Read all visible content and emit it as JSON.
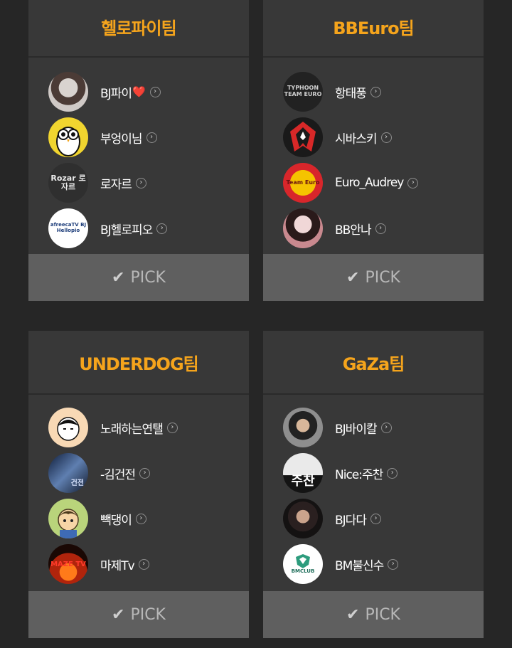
{
  "teams": [
    {
      "name": "헬로파이팀",
      "members": [
        {
          "name": "BJ파이",
          "suffix": "❤️",
          "avatar": "photo"
        },
        {
          "name": "부엉이님",
          "avatar": "owl"
        },
        {
          "name": "로자르",
          "avatar": "rozar",
          "avatar_text": "Rozar 로자르"
        },
        {
          "name": "BJ헬로피오",
          "avatar": "hellopio",
          "avatar_text": "afreecaTV BJ Hellopio"
        }
      ],
      "pick_label": "PICK"
    },
    {
      "name": "BBEuro팀",
      "members": [
        {
          "name": "항태풍",
          "avatar": "typhoon",
          "avatar_text": "TYPHOON TEAM EURO"
        },
        {
          "name": "시바스키",
          "avatar": "shibasky"
        },
        {
          "name": "Euro_Audrey",
          "avatar": "teameuro",
          "avatar_text": "Team Euro"
        },
        {
          "name": "BB안나",
          "avatar": "photo2"
        }
      ],
      "pick_label": "PICK"
    },
    {
      "name": "UNDERDOG팀",
      "members": [
        {
          "name": "노래하는연탤",
          "avatar": "cartoon"
        },
        {
          "name": "-김건전",
          "avatar": "photo3",
          "avatar_text": "건전"
        },
        {
          "name": "빽댕이",
          "avatar": "cartoon2"
        },
        {
          "name": "마제Tv",
          "avatar": "maze",
          "avatar_text": "MAZE TV"
        }
      ],
      "pick_label": "PICK"
    },
    {
      "name": "GaZa팀",
      "members": [
        {
          "name": "BJ바이칼",
          "avatar": "photo4"
        },
        {
          "name": "Nice:주찬",
          "avatar": "juchan",
          "avatar_text": "주찬"
        },
        {
          "name": "BJ다다",
          "avatar": "photo5"
        },
        {
          "name": "BM불신수",
          "avatar": "bmclub",
          "avatar_text": "BMCLUB"
        }
      ],
      "pick_label": "PICK"
    }
  ],
  "colors": {
    "accent": "#f5a41c",
    "card_bg": "#383838",
    "page_bg": "#262626",
    "pick_bg": "#5f5f5f"
  }
}
